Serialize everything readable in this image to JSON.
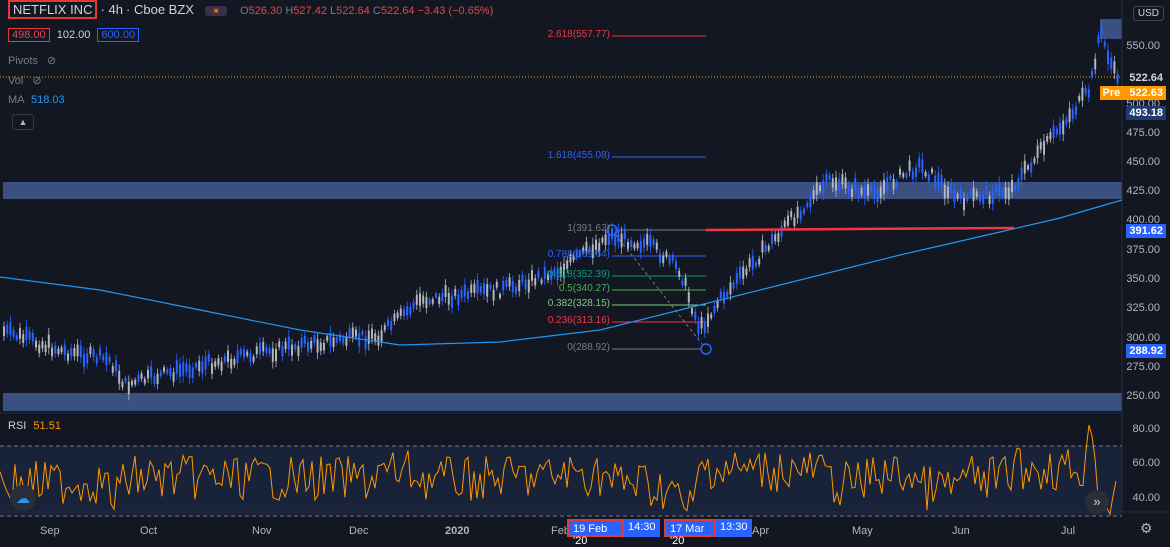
{
  "symbol": {
    "name": "NETFLIX INC",
    "interval": "4h",
    "exchange": "Cboe BZX",
    "ohlc": {
      "o_label": "O",
      "o": "526.30",
      "h_label": "H",
      "h": "527.42",
      "l_label": "L",
      "l": "522.64",
      "c_label": "C",
      "c": "522.64",
      "change": "−3.43 (−0.65%)"
    },
    "bid": "498.00",
    "spread": "102.00",
    "ask": "600.00"
  },
  "indicators": {
    "pivots": "Pivots",
    "vol": "Vol",
    "ma_label": "MA",
    "ma_value": "518.03",
    "rsi_label": "RSI",
    "rsi_value": "51.51"
  },
  "currency": "USD",
  "price_axis": {
    "labels": [
      "550.00",
      "500.00",
      "475.00",
      "450.00",
      "425.00",
      "400.00",
      "375.00",
      "350.00",
      "325.00",
      "300.00",
      "275.00",
      "250.00"
    ],
    "last_price": "522.64",
    "pre_label": "Pre",
    "pre_price": "522.63",
    "tag_493": "493.18",
    "tag_391": "391.62",
    "tag_288": "288.92"
  },
  "rsi_axis": {
    "labels": [
      "80.00",
      "60.00",
      "40.00"
    ]
  },
  "fib_levels": [
    {
      "label": "2.618(557.77)",
      "color": "#f23645"
    },
    {
      "label": "1.618(455.08)",
      "color": "#2962ff"
    },
    {
      "label": "1(391.62)",
      "color": "#787b86"
    },
    {
      "label": "0.786(369.64)",
      "color": "#2962ff"
    },
    {
      "label": "0.618(352.39)",
      "color": "#089981"
    },
    {
      "label": "0.5(340.27)",
      "color": "#4caf50"
    },
    {
      "label": "0.382(328.15)",
      "color": "#81c784"
    },
    {
      "label": "0.236(313.16)",
      "color": "#f23645"
    },
    {
      "label": "0(288.92)",
      "color": "#787b86"
    }
  ],
  "time_axis": {
    "labels": [
      "Sep",
      "Oct",
      "Nov",
      "Dec",
      "2020",
      "Feb",
      "Apr",
      "May",
      "Jun",
      "Jul"
    ],
    "tag_start_date": "19 Feb '20",
    "tag_start_time": "14:30",
    "tag_end_date": "17 Mar '20",
    "tag_end_time": "13:30"
  },
  "colors": {
    "background": "#131722",
    "up": "#2962ff",
    "ma": "#2196f3",
    "rsi": "#ff9800",
    "zone": "#5b7bc7",
    "trendline": "#f23645"
  }
}
